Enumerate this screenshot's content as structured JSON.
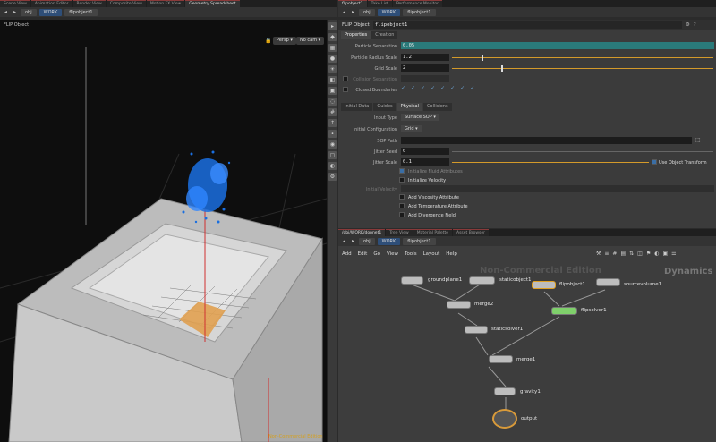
{
  "left_tabs": [
    "Scene View",
    "Animation Editor",
    "Render View",
    "Composite View",
    "Motion FX View",
    "Geometry Spreadsheet"
  ],
  "right_top_tabs": [
    "flipobject1",
    "Take List",
    "Performance Monitor"
  ],
  "left_path": {
    "root": "obj",
    "net": "WORK",
    "node": "flipobject1"
  },
  "right_path": {
    "root": "obj",
    "net": "WORK",
    "node": "flipobject1"
  },
  "viewport": {
    "title": "FLIP Object",
    "camera_persp": "Persp",
    "camera_cam": "No cam",
    "watermark": "Non-Commercial Edition"
  },
  "params": {
    "node_type": "FLIP Object",
    "node_name": "flipobject1",
    "tabs": [
      "Properties",
      "Creation"
    ],
    "rows": [
      {
        "label": "Particle Separation",
        "value": "0.05"
      },
      {
        "label": "Particle Radius Scale",
        "value": "1.2"
      },
      {
        "label": "Grid Scale",
        "value": "2"
      }
    ],
    "collision_sep_label": "Collision Separation",
    "closed_boundaries_label": "Closed Boundaries",
    "sub_tabs": [
      "Initial Data",
      "Guides",
      "Physical",
      "Collisions"
    ],
    "input_type_label": "Input Type",
    "input_type_value": "Surface SOP",
    "initial_config_label": "Initial Configuration",
    "initial_config_value": "Grid",
    "sop_path_label": "SOP Path",
    "jitter_seed_label": "Jitter Seed",
    "jitter_seed_value": "0",
    "jitter_scale_label": "Jitter Scale",
    "jitter_scale_value": "0.1",
    "use_object_transform": "Use Object Transform",
    "initialize_fluid": "Initialize Fluid Attributes",
    "initialize_velocity": "Initialize Velocity",
    "velocity_label": "Initial Velocity",
    "add_viscosity": "Add Viscosity Attribute",
    "add_temperature": "Add Temperature Attribute",
    "add_divergence": "Add Divergence Field"
  },
  "network_tabs": [
    "/obj/WORK/dopnet1",
    "Tree View",
    "Material Palette",
    "Asset Browser"
  ],
  "network_menu": [
    "Add",
    "Edit",
    "Go",
    "View",
    "Tools",
    "Layout",
    "Help"
  ],
  "network": {
    "watermark": "Non-Commercial Edition",
    "context": "Dynamics",
    "nodes": {
      "groundplane": "groundplane1",
      "staticobject": "staticobject1",
      "flipobject": "flipobject1",
      "sourcevolume": "sourcevolume1",
      "merge2": "merge2",
      "flipsolver": "flipsolver1",
      "staticsolver": "staticsolver1",
      "merge1": "merge1",
      "gravity": "gravity1",
      "output": "output"
    }
  },
  "colors": {
    "accent_blue": "#2e4e78",
    "particle_blue": "#1a6fe0",
    "flip_solver_green": "#7fd06b",
    "flip_object_orange": "#e0a020",
    "field_teal": "#2a7a7a"
  }
}
